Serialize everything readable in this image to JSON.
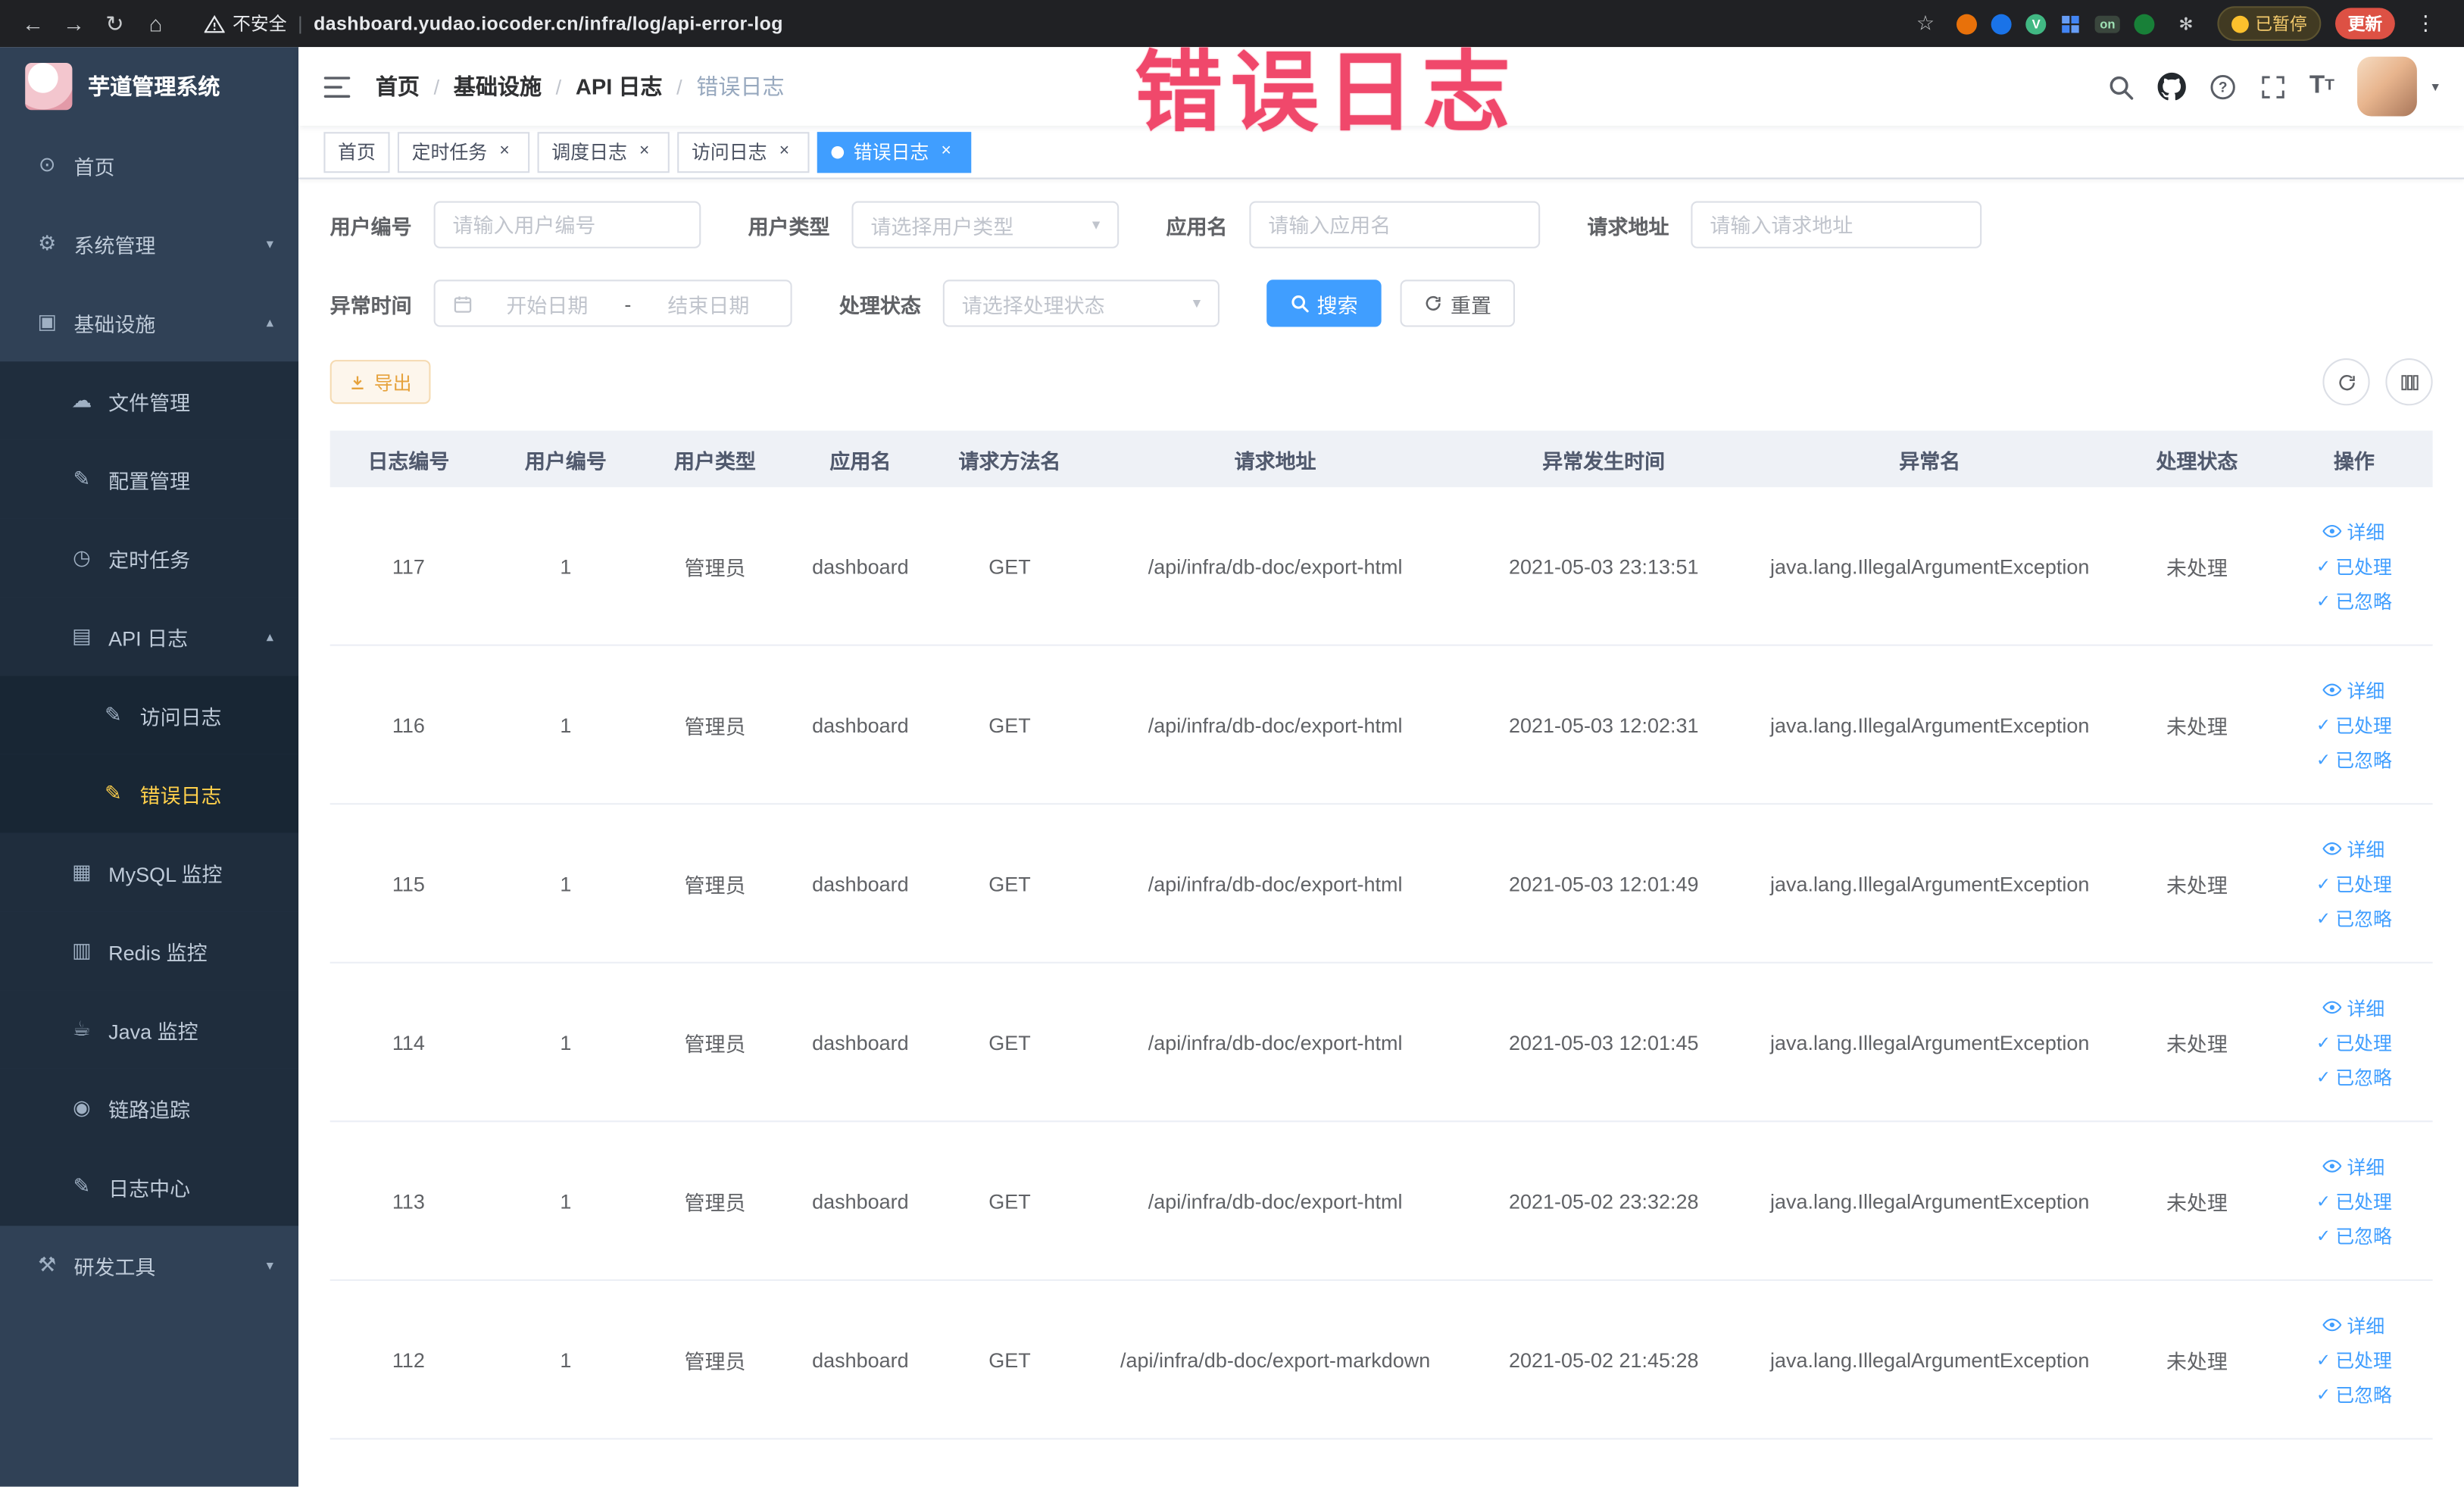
{
  "browser": {
    "security_label": "不安全",
    "url": "dashboard.yudao.iocoder.cn/infra/log/api-error-log",
    "on_badge": "on",
    "paused_label": "已暂停",
    "update_label": "更新"
  },
  "watermark": "错误日志",
  "sidebar": {
    "logo_title": "芋道管理系统",
    "items": [
      {
        "label": "首页"
      },
      {
        "label": "系统管理"
      },
      {
        "label": "基础设施"
      },
      {
        "label": "文件管理"
      },
      {
        "label": "配置管理"
      },
      {
        "label": "定时任务"
      },
      {
        "label": "API 日志"
      },
      {
        "label": "访问日志"
      },
      {
        "label": "错误日志"
      },
      {
        "label": "MySQL 监控"
      },
      {
        "label": "Redis 监控"
      },
      {
        "label": "Java 监控"
      },
      {
        "label": "链路追踪"
      },
      {
        "label": "日志中心"
      },
      {
        "label": "研发工具"
      }
    ]
  },
  "breadcrumb": {
    "separator": "/",
    "items": [
      "首页",
      "基础设施",
      "API 日志",
      "错误日志"
    ]
  },
  "tabs": [
    {
      "label": "首页"
    },
    {
      "label": "定时任务"
    },
    {
      "label": "调度日志"
    },
    {
      "label": "访问日志"
    },
    {
      "label": "错误日志"
    }
  ],
  "filters": {
    "user_id_label": "用户编号",
    "user_id_placeholder": "请输入用户编号",
    "user_type_label": "用户类型",
    "user_type_placeholder": "请选择用户类型",
    "app_name_label": "应用名",
    "app_name_placeholder": "请输入应用名",
    "request_url_label": "请求地址",
    "request_url_placeholder": "请输入请求地址",
    "exception_time_label": "异常时间",
    "start_date_placeholder": "开始日期",
    "end_date_placeholder": "结束日期",
    "date_separator": "-",
    "process_status_label": "处理状态",
    "process_status_placeholder": "请选择处理状态",
    "search_button": "搜索",
    "reset_button": "重置"
  },
  "toolbar": {
    "export_button": "导出"
  },
  "table": {
    "columns": [
      "日志编号",
      "用户编号",
      "用户类型",
      "应用名",
      "请求方法名",
      "请求地址",
      "异常发生时间",
      "异常名",
      "处理状态",
      "操作"
    ],
    "row_actions": [
      "详细",
      "已处理",
      "已忽略"
    ],
    "rows": [
      {
        "log_id": "117",
        "user_id": "1",
        "user_type": "管理员",
        "app_name": "dashboard",
        "method": "GET",
        "url": "/api/infra/db-doc/export-html",
        "time": "2021-05-03 23:13:51",
        "exception": "java.lang.IllegalArgumentException",
        "status": "未处理"
      },
      {
        "log_id": "116",
        "user_id": "1",
        "user_type": "管理员",
        "app_name": "dashboard",
        "method": "GET",
        "url": "/api/infra/db-doc/export-html",
        "time": "2021-05-03 12:02:31",
        "exception": "java.lang.IllegalArgumentException",
        "status": "未处理"
      },
      {
        "log_id": "115",
        "user_id": "1",
        "user_type": "管理员",
        "app_name": "dashboard",
        "method": "GET",
        "url": "/api/infra/db-doc/export-html",
        "time": "2021-05-03 12:01:49",
        "exception": "java.lang.IllegalArgumentException",
        "status": "未处理"
      },
      {
        "log_id": "114",
        "user_id": "1",
        "user_type": "管理员",
        "app_name": "dashboard",
        "method": "GET",
        "url": "/api/infra/db-doc/export-html",
        "time": "2021-05-03 12:01:45",
        "exception": "java.lang.IllegalArgumentException",
        "status": "未处理"
      },
      {
        "log_id": "113",
        "user_id": "1",
        "user_type": "管理员",
        "app_name": "dashboard",
        "method": "GET",
        "url": "/api/infra/db-doc/export-html",
        "time": "2021-05-02 23:32:28",
        "exception": "java.lang.IllegalArgumentException",
        "status": "未处理"
      },
      {
        "log_id": "112",
        "user_id": "1",
        "user_type": "管理员",
        "app_name": "dashboard",
        "method": "GET",
        "url": "/api/infra/db-doc/export-markdown",
        "time": "2021-05-02 21:45:28",
        "exception": "java.lang.IllegalArgumentException",
        "status": "未处理"
      }
    ]
  }
}
